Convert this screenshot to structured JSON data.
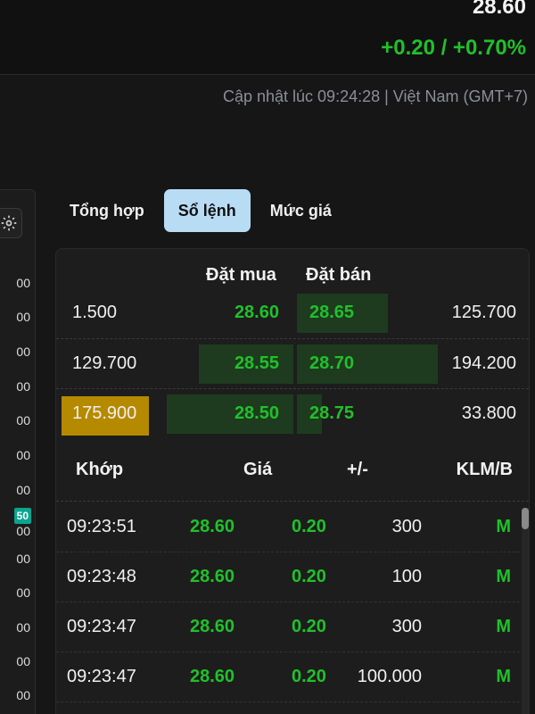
{
  "quote": {
    "price": "28.60",
    "change": "+0.20 / +0.70%"
  },
  "updated_text": "Cập nhật lúc 09:24:28 | Việt Nam (GMT+7)",
  "left_axis": {
    "ticks": [
      "00",
      "00",
      "00",
      "00",
      "00",
      "00",
      "00",
      "00",
      "00",
      "00",
      "00",
      "00",
      "00",
      "00"
    ],
    "badge": "50"
  },
  "tabs": [
    {
      "label": "Tổng hợp",
      "active": false
    },
    {
      "label": "Sổ lệnh",
      "active": true
    },
    {
      "label": "Mức giá",
      "active": false
    }
  ],
  "order_book": {
    "bid_header": "Đặt mua",
    "ask_header": "Đặt bán",
    "rows": [
      {
        "bid_vol": "1.500",
        "bid_price": "28.60",
        "ask_price": "28.65",
        "ask_vol": "125.700"
      },
      {
        "bid_vol": "129.700",
        "bid_price": "28.55",
        "ask_price": "28.70",
        "ask_vol": "194.200"
      },
      {
        "bid_vol": "175.900",
        "bid_price": "28.50",
        "ask_price": "28.75",
        "ask_vol": "33.800"
      }
    ]
  },
  "trades": {
    "headers": {
      "time": "Khớp",
      "price": "Giá",
      "change": "+/-",
      "volume": "KLM/B"
    },
    "rows": [
      {
        "time": "09:23:51",
        "price": "28.60",
        "change": "0.20",
        "volume": "300",
        "side": "M"
      },
      {
        "time": "09:23:48",
        "price": "28.60",
        "change": "0.20",
        "volume": "100",
        "side": "M"
      },
      {
        "time": "09:23:47",
        "price": "28.60",
        "change": "0.20",
        "volume": "300",
        "side": "M"
      },
      {
        "time": "09:23:47",
        "price": "28.60",
        "change": "0.20",
        "volume": "100.000",
        "side": "M"
      }
    ]
  },
  "colors": {
    "up": "#21c02b",
    "highlight": "#b58a00",
    "active_tab": "#b9dcf5"
  },
  "icons": {
    "settings": "gear-icon"
  }
}
